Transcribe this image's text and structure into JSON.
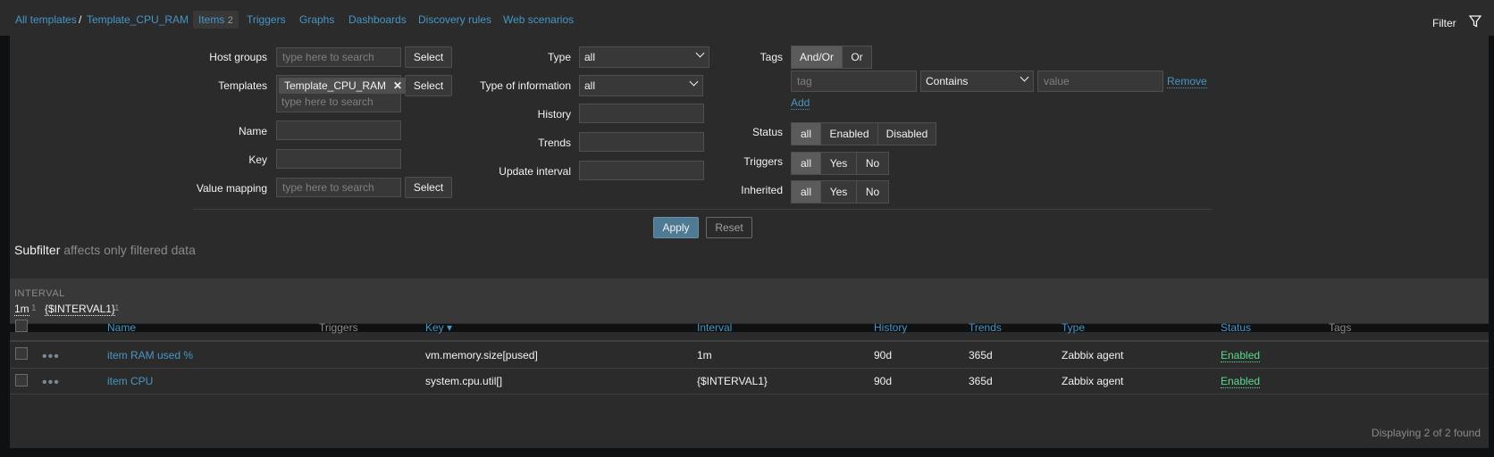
{
  "breadcrumb": {
    "all_templates": "All templates",
    "separator": "/",
    "template": "Template_CPU_RAM"
  },
  "tabs": [
    {
      "label": "Items",
      "count": "2",
      "active": true
    },
    {
      "label": "Triggers"
    },
    {
      "label": "Graphs"
    },
    {
      "label": "Dashboards"
    },
    {
      "label": "Discovery rules"
    },
    {
      "label": "Web scenarios"
    }
  ],
  "filter_tab": {
    "label": "Filter",
    "icon": "funnel-icon"
  },
  "filter": {
    "host_groups": {
      "label": "Host groups",
      "placeholder": "type here to search",
      "button": "Select"
    },
    "templates": {
      "label": "Templates",
      "chip": "Template_CPU_RAM",
      "chip_remove": "✕",
      "placeholder": "type here to search",
      "button": "Select"
    },
    "name": {
      "label": "Name",
      "value": ""
    },
    "key": {
      "label": "Key",
      "value": ""
    },
    "value_mapping": {
      "label": "Value mapping",
      "placeholder": "type here to search",
      "button": "Select"
    },
    "type": {
      "label": "Type",
      "value": "all"
    },
    "type_of_information": {
      "label": "Type of information",
      "value": "all"
    },
    "history": {
      "label": "History",
      "value": ""
    },
    "trends": {
      "label": "Trends",
      "value": ""
    },
    "update_interval": {
      "label": "Update interval",
      "value": ""
    },
    "tags": {
      "label": "Tags",
      "andor": "And/Or",
      "or": "Or",
      "tag_placeholder": "tag",
      "operator": "Contains",
      "value_placeholder": "value",
      "remove": "Remove",
      "add": "Add"
    },
    "status": {
      "label": "Status",
      "options": [
        "all",
        "Enabled",
        "Disabled"
      ]
    },
    "triggers": {
      "label": "Triggers",
      "options": [
        "all",
        "Yes",
        "No"
      ]
    },
    "inherited": {
      "label": "Inherited",
      "options": [
        "all",
        "Yes",
        "No"
      ]
    },
    "apply": "Apply",
    "reset": "Reset"
  },
  "subfilter": {
    "title": "Subfilter",
    "note": "affects only filtered data",
    "group_label": "INTERVAL",
    "values": [
      {
        "label": "1m",
        "count": "1"
      },
      {
        "label": "{$INTERVAL1}",
        "count": "1"
      }
    ]
  },
  "table": {
    "headers": {
      "name": "Name",
      "triggers": "Triggers",
      "key": "Key ▾",
      "interval": "Interval",
      "history": "History",
      "trends": "Trends",
      "type": "Type",
      "status": "Status",
      "tags": "Tags"
    },
    "rows": [
      {
        "name": "item RAM used %",
        "triggers": "",
        "key": "vm.memory.size[pused]",
        "interval": "1m",
        "history": "90d",
        "trends": "365d",
        "type": "Zabbix agent",
        "status": "Enabled",
        "tags": ""
      },
      {
        "name": "item CPU",
        "triggers": "",
        "key": "system.cpu.util[]",
        "interval": "{$INTERVAL1}",
        "history": "90d",
        "trends": "365d",
        "type": "Zabbix agent",
        "status": "Enabled",
        "tags": ""
      }
    ],
    "footer": "Displaying 2 of 2 found"
  },
  "colors": {
    "link": "#4796c4",
    "enabled": "#59db8f",
    "panel": "#2b2b2b",
    "apply": "#4f7a94"
  }
}
